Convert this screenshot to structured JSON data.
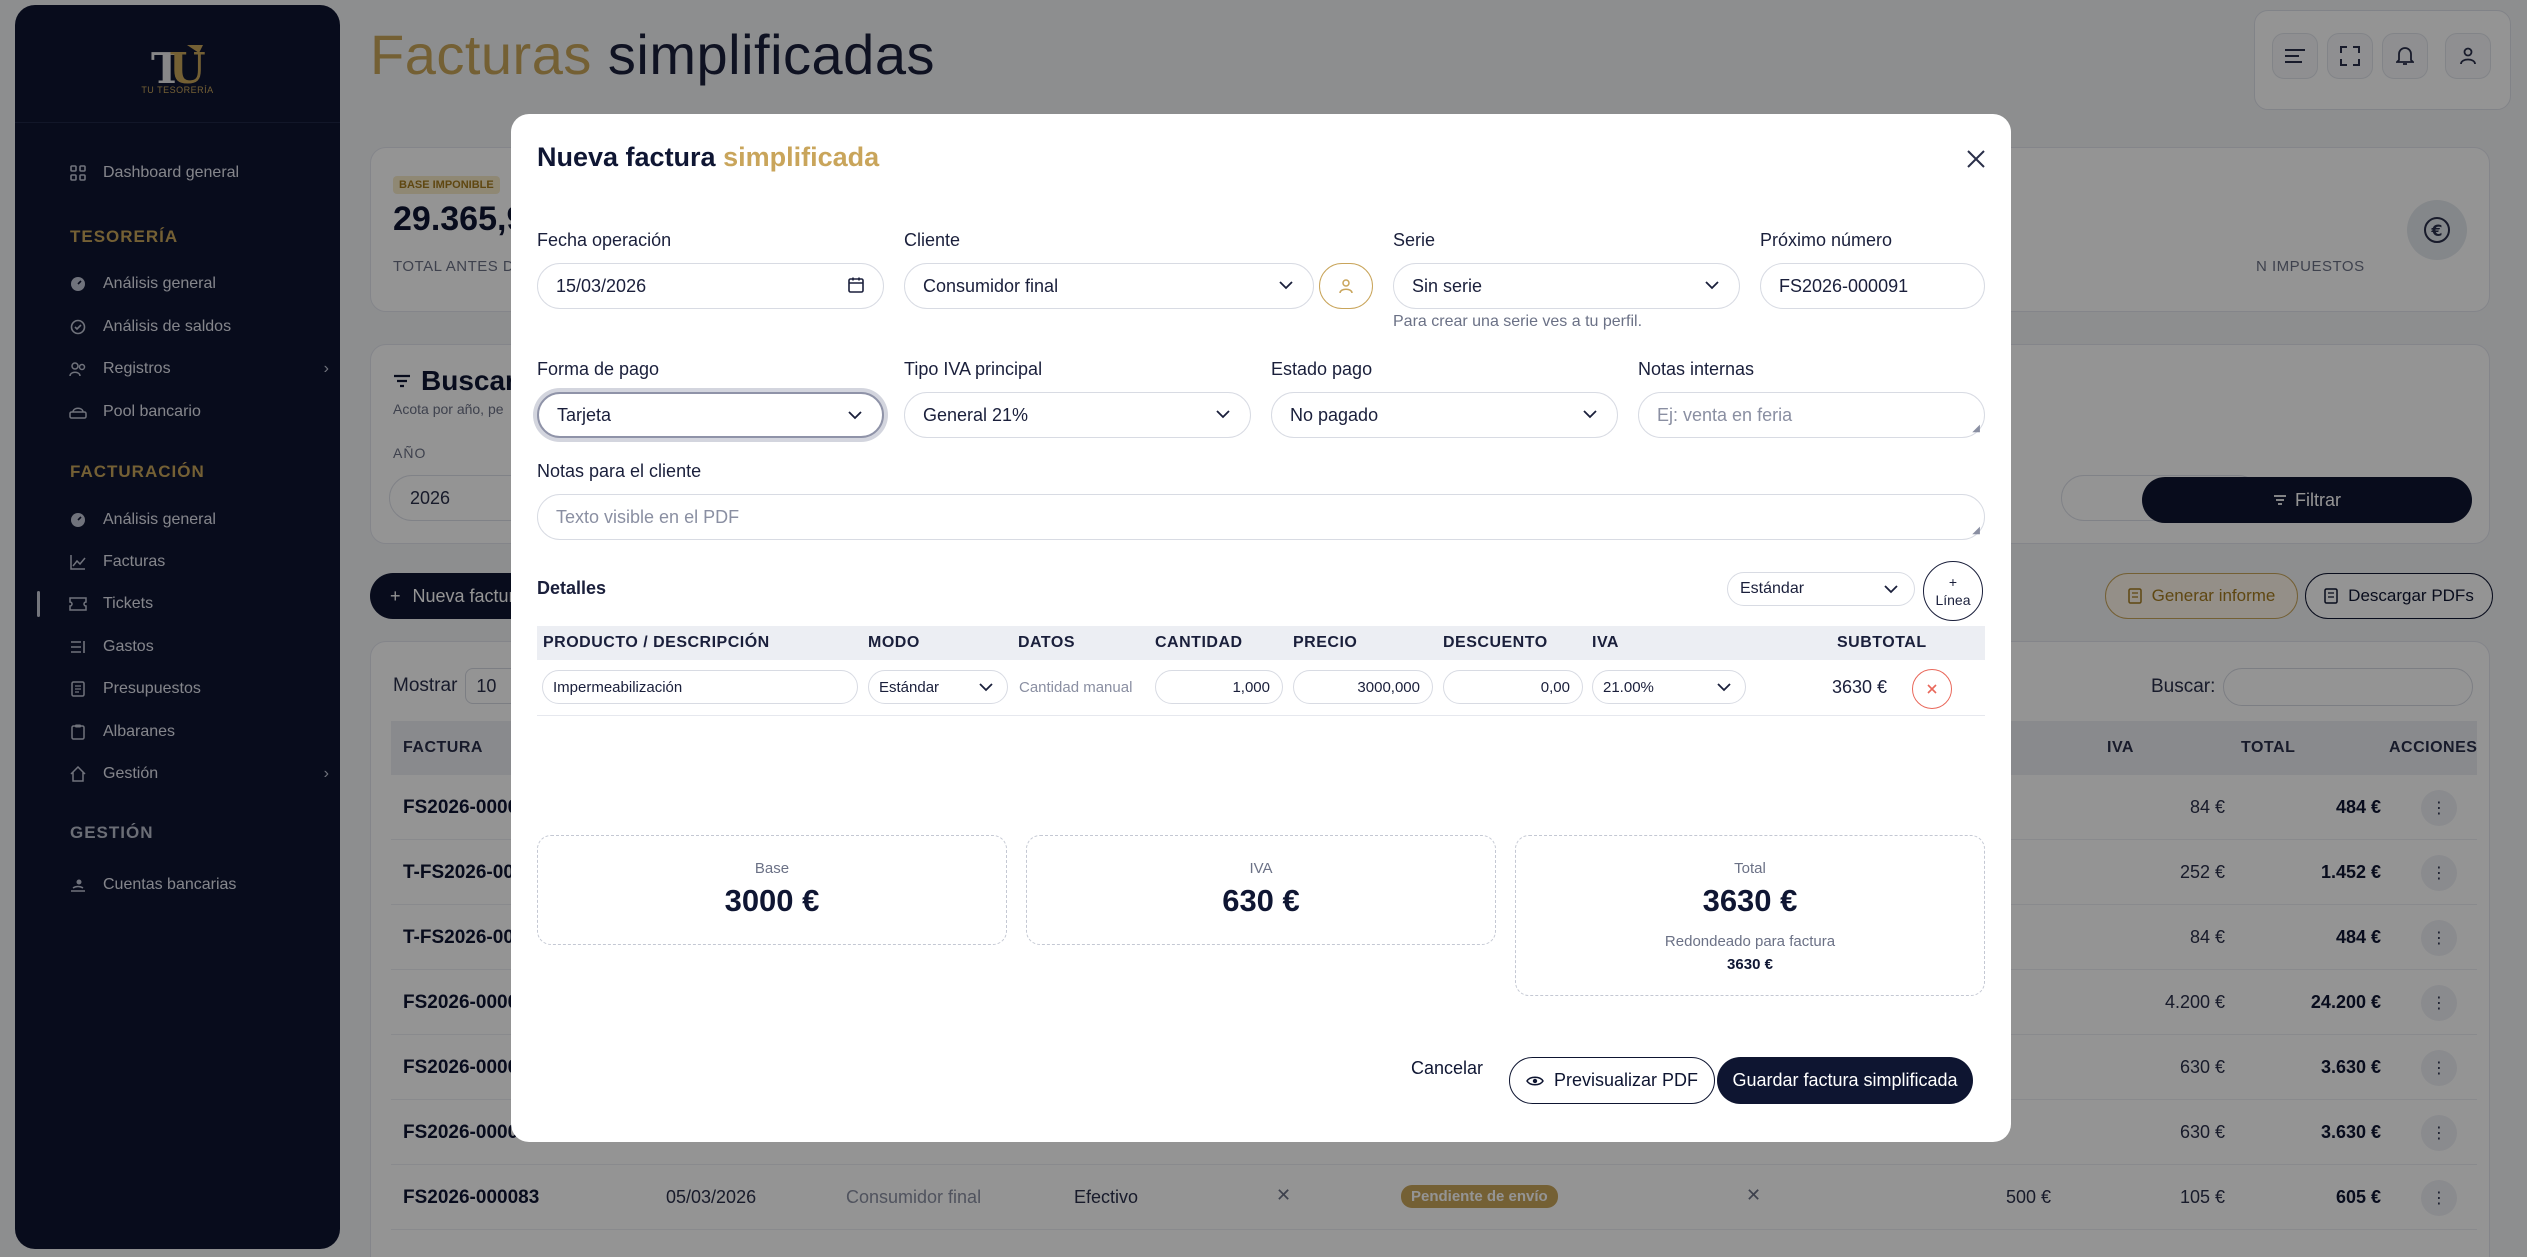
{
  "sidebar": {
    "logo_text": "TU TESORERÍA",
    "dashboard": "Dashboard general",
    "tesoreria_title": "TESORERÍA",
    "tesoreria_items": [
      "Análisis general",
      "Análisis de saldos",
      "Registros",
      "Pool bancario"
    ],
    "facturacion_title": "FACTURACIÓN",
    "facturacion_items": [
      "Análisis general",
      "Facturas",
      "Tickets",
      "Gastos",
      "Presupuestos",
      "Albaranes",
      "Gestión"
    ],
    "gestion_title": "GESTIÓN",
    "gestion_items": [
      "Cuentas bancarias"
    ]
  },
  "page": {
    "title_part1": "Facturas",
    "title_part2": "simplificadas",
    "kpi_badge": "BASE IMPONIBLE",
    "kpi_value": "29.365,9",
    "kpi_label": "TOTAL ANTES DE",
    "kpi_label_right": "N IMPUESTOS",
    "filter_title": "Buscar",
    "filter_desc": "Acota por año, pe",
    "filter_anio_label": "AÑO",
    "filter_anio_value": "2026",
    "filtrar_label": "Filtrar",
    "nueva_label": "Nueva factur",
    "generar_informe": "Generar informe",
    "descargar_pdfs": "Descargar PDFs",
    "mostrar_label": "Mostrar",
    "mostrar_value": "10",
    "buscar_label": "Buscar:",
    "columns": {
      "factura": "FACTURA",
      "iva": "IVA",
      "total": "TOTAL",
      "acciones": "ACCIONES"
    },
    "rows": [
      {
        "factura": "FS2026-0000",
        "iva": "84 €",
        "total": "484 €"
      },
      {
        "factura": "T-FS2026-00",
        "iva": "252 €",
        "total": "1.452 €"
      },
      {
        "factura": "T-FS2026-00",
        "iva": "84 €",
        "total": "484 €"
      },
      {
        "factura": "FS2026-0000",
        "iva": "4.200 €",
        "total": "24.200 €"
      },
      {
        "factura": "FS2026-0000",
        "iva": "630 €",
        "total": "3.630 €"
      },
      {
        "factura": "FS2026-0000",
        "iva": "630 €",
        "total": "3.630 €"
      }
    ],
    "last_row": {
      "factura": "FS2026-000083",
      "fecha": "05/03/2026",
      "cliente": "Consumidor final",
      "pago": "Efectivo",
      "estado": "Pendiente de envío",
      "base": "500 €",
      "iva": "105 €",
      "total": "605 €"
    }
  },
  "modal": {
    "title_part1": "Nueva factura",
    "title_part2": "simplificada",
    "fecha_label": "Fecha operación",
    "fecha_value": "15/03/2026",
    "cliente_label": "Cliente",
    "cliente_value": "Consumidor final",
    "serie_label": "Serie",
    "serie_value": "Sin serie",
    "serie_hint": "Para crear una serie ves a tu perfil.",
    "proximo_label": "Próximo número",
    "proximo_value": "FS2026-000091",
    "forma_pago_label": "Forma de pago",
    "forma_pago_value": "Tarjeta",
    "tipo_iva_label": "Tipo IVA principal",
    "tipo_iva_value": "General 21%",
    "estado_pago_label": "Estado pago",
    "estado_pago_value": "No pagado",
    "notas_internas_label": "Notas internas",
    "notas_internas_placeholder": "Ej: venta en feria",
    "notas_cliente_label": "Notas para el cliente",
    "notas_cliente_placeholder": "Texto visible en el PDF",
    "detalles_title": "Detalles",
    "detalles_mode": "Estándar",
    "linea_plus": "+",
    "linea_label": "Línea",
    "columns": {
      "producto": "PRODUCTO / DESCRIPCIÓN",
      "modo": "MODO",
      "datos": "DATOS",
      "cantidad": "CANTIDAD",
      "precio": "PRECIO",
      "descuento": "DESCUENTO",
      "iva": "IVA",
      "subtotal": "SUBTOTAL"
    },
    "line": {
      "producto": "Impermeabilización",
      "modo": "Estándar",
      "datos": "Cantidad manual",
      "cantidad": "1,000",
      "precio": "3000,000",
      "descuento": "0,00",
      "iva": "21.00%",
      "subtotal": "3630 €"
    },
    "summary": {
      "base_label": "Base",
      "base_value": "3000 €",
      "iva_label": "IVA",
      "iva_value": "630 €",
      "total_label": "Total",
      "total_value": "3630 €",
      "redondeado_label": "Redondeado para factura",
      "redondeado_value": "3630 €"
    },
    "cancel_label": "Cancelar",
    "preview_label": "Previsualizar PDF",
    "save_label": "Guardar factura simplificada"
  },
  "colors": {
    "brand_dark": "#0e1531",
    "accent_gold": "#c9a55b",
    "danger": "#e9675a"
  }
}
